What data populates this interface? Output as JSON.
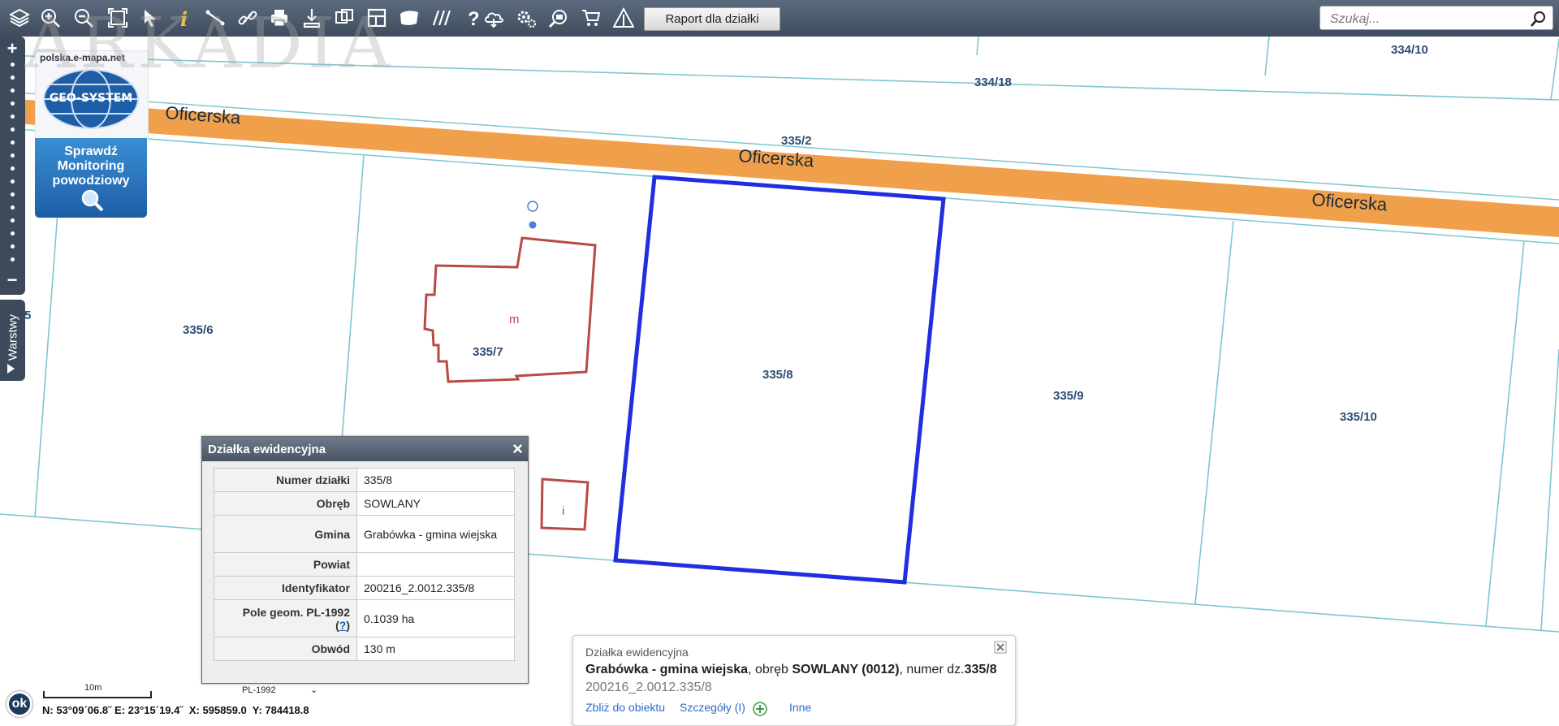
{
  "toolbar": {
    "icons": [
      "layers-icon",
      "zoom-in-icon",
      "zoom-out-icon",
      "zoom-extent-icon",
      "pointer-icon",
      "info-icon",
      "measure-icon",
      "link-icon",
      "print-icon",
      "download-icon",
      "compare-icon",
      "layout-icon",
      "map-icon",
      "hatch-icon",
      "help-icon",
      "cloud-icon",
      "settings-icon",
      "search-map-icon",
      "cart-icon",
      "warning-icon"
    ],
    "report_label": "Raport dla działki"
  },
  "search": {
    "placeholder": "Szukaj..."
  },
  "watermark": "ARKADIA",
  "promo": {
    "site": "polska.e-mapa.net",
    "logo": "GEO-SYSTEM",
    "flood_text": "Sprawdź\nMonitoring\npowodziowy"
  },
  "layers_tab": {
    "label": "Warstwy"
  },
  "map": {
    "road_name": "Oficerska",
    "parcels": [
      "334/10",
      "334/18",
      "335/2",
      "335/6",
      "335/7",
      "335/8",
      "335/9",
      "335/10",
      "5"
    ],
    "building_codes": [
      "m",
      "i"
    ]
  },
  "info_panel": {
    "title": "Działka ewidencyjna",
    "rows": [
      {
        "label": "Numer działki",
        "value": "335/8"
      },
      {
        "label": "Obręb",
        "value": "SOWLANY"
      },
      {
        "label": "Gmina",
        "value": "Grabówka - gmina wiejska"
      },
      {
        "label": "Powiat",
        "value": ""
      },
      {
        "label": "Identyfikator",
        "value": "200216_2.0012.335/8"
      },
      {
        "label": "Pole geom. PL-1992",
        "value": "0.1039 ha"
      },
      {
        "label": "Obwód",
        "value": "130 m"
      }
    ],
    "help_link": "?"
  },
  "status": {
    "ok": "ok",
    "scale": "10m",
    "crs": "PL-1992",
    "crs_chevron": "⌄",
    "coords": "N: 53°09´06.8˝ E: 23°15´19.4˝  X: 595859.0  Y: 784418.8"
  },
  "popup": {
    "title": "Działka ewidencyjna",
    "gmina": "Grabówka - gmina wiejska",
    "obreb_prefix": ", obręb ",
    "obreb": "SOWLANY (0012)",
    "numer_prefix": ", numer dz.",
    "numer": "335/8",
    "id": "200216_2.0012.335/8",
    "actions": [
      "Zbliż do obiektu",
      "Szczegóły (I)",
      "Inne"
    ]
  },
  "colors": {
    "toolbar": "#4a5869",
    "road": "#f0a04b",
    "parcel_line": "#7fc6cf",
    "selected_parcel": "#1f2fe0",
    "building": "#b84a45",
    "label": "#2d4e73"
  }
}
